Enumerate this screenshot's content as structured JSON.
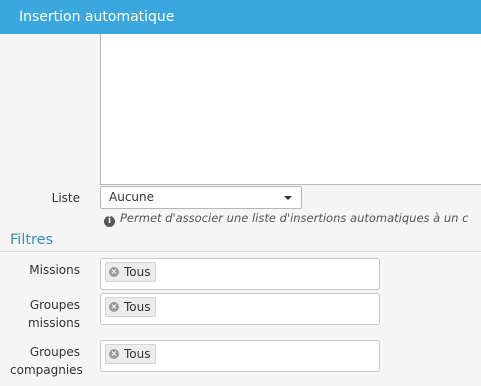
{
  "dialog": {
    "title": "Insertion automatique"
  },
  "liste": {
    "label": "Liste",
    "selected": "Aucune",
    "help": "Permet d'associer une liste d'insertions automatiques à un c"
  },
  "filtres": {
    "title": "Filtres",
    "missions": {
      "label": "Missions",
      "tag": "Tous"
    },
    "groupes_missions": {
      "label_line1": "Groupes",
      "label_line2": "missions",
      "tag": "Tous"
    },
    "groupes_compagnies": {
      "label_line1": "Groupes",
      "label_line2": "compagnies",
      "tag": "Tous"
    }
  },
  "icons": {
    "info": "info-circle-icon",
    "remove": "remove-tag-icon",
    "caret": "caret-down-icon"
  },
  "colors": {
    "header": "#3aa7dd",
    "section_title": "#3a8bc7"
  }
}
